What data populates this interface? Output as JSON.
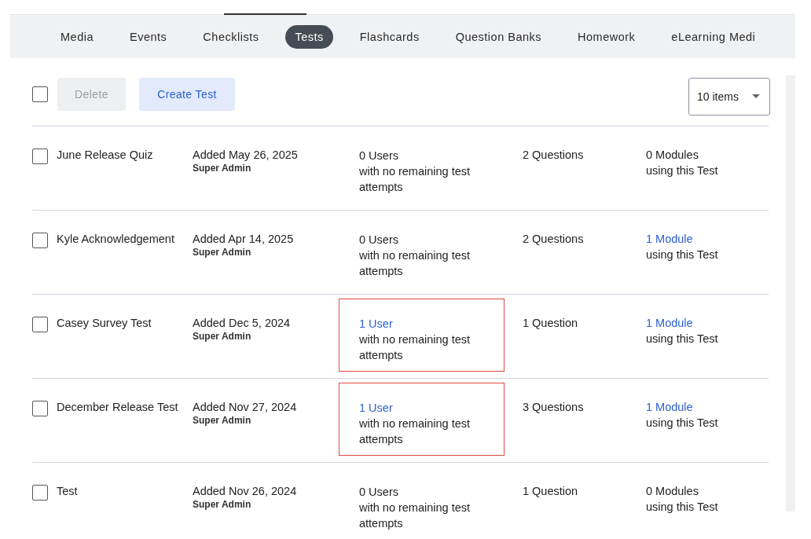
{
  "tabs": [
    {
      "label": "Media",
      "selected": false
    },
    {
      "label": "Events",
      "selected": false
    },
    {
      "label": "Checklists",
      "selected": false
    },
    {
      "label": "Tests",
      "selected": true
    },
    {
      "label": "Flashcards",
      "selected": false
    },
    {
      "label": "Question Banks",
      "selected": false
    },
    {
      "label": "Homework",
      "selected": false
    },
    {
      "label": "eLearning Medi",
      "selected": false
    }
  ],
  "toolbar": {
    "select_all_checked": false,
    "delete_button": {
      "label": "Delete",
      "disabled": true
    },
    "create_button": "Create Test",
    "page_size": "10 items"
  },
  "rows": [
    {
      "checked": false,
      "name": "June Release Quiz",
      "added": "Added May 26, 2025",
      "added_by": "Super Admin",
      "users": {
        "count": "0 Users",
        "link": false,
        "highlighted": false
      },
      "users_note": "with no remaining test attempts",
      "questions": "2 Questions",
      "modules": {
        "count": "0 Modules",
        "link": false
      },
      "modules_note": "using this Test"
    },
    {
      "checked": false,
      "name": "Kyle Acknowledgement",
      "added": "Added Apr 14, 2025",
      "added_by": "Super Admin",
      "users": {
        "count": "0 Users",
        "link": false,
        "highlighted": false
      },
      "users_note": "with no remaining test attempts",
      "questions": "2 Questions",
      "modules": {
        "count": "1 Module",
        "link": true
      },
      "modules_note": "using this Test"
    },
    {
      "checked": false,
      "name": "Casey Survey Test",
      "added": "Added Dec 5, 2024",
      "added_by": "Super Admin",
      "users": {
        "count": "1 User",
        "link": true,
        "highlighted": true
      },
      "users_note": "with no remaining test attempts",
      "questions": "1 Question",
      "modules": {
        "count": "1 Module",
        "link": true
      },
      "modules_note": "using this Test"
    },
    {
      "checked": false,
      "name": "December Release Test",
      "added": "Added Nov 27, 2024",
      "added_by": "Super Admin",
      "users": {
        "count": "1 User",
        "link": true,
        "highlighted": true
      },
      "users_note": "with no remaining test attempts",
      "questions": "3 Questions",
      "modules": {
        "count": "1 Module",
        "link": true
      },
      "modules_note": "using this Test"
    },
    {
      "checked": false,
      "name": "Test",
      "added": "Added Nov 26, 2024",
      "added_by": "Super Admin",
      "users": {
        "count": "0 Users",
        "link": false,
        "highlighted": false
      },
      "users_note": "with no remaining test attempts",
      "questions": "1 Question",
      "modules": {
        "count": "0 Modules",
        "link": false
      },
      "modules_note": "using this Test"
    }
  ]
}
